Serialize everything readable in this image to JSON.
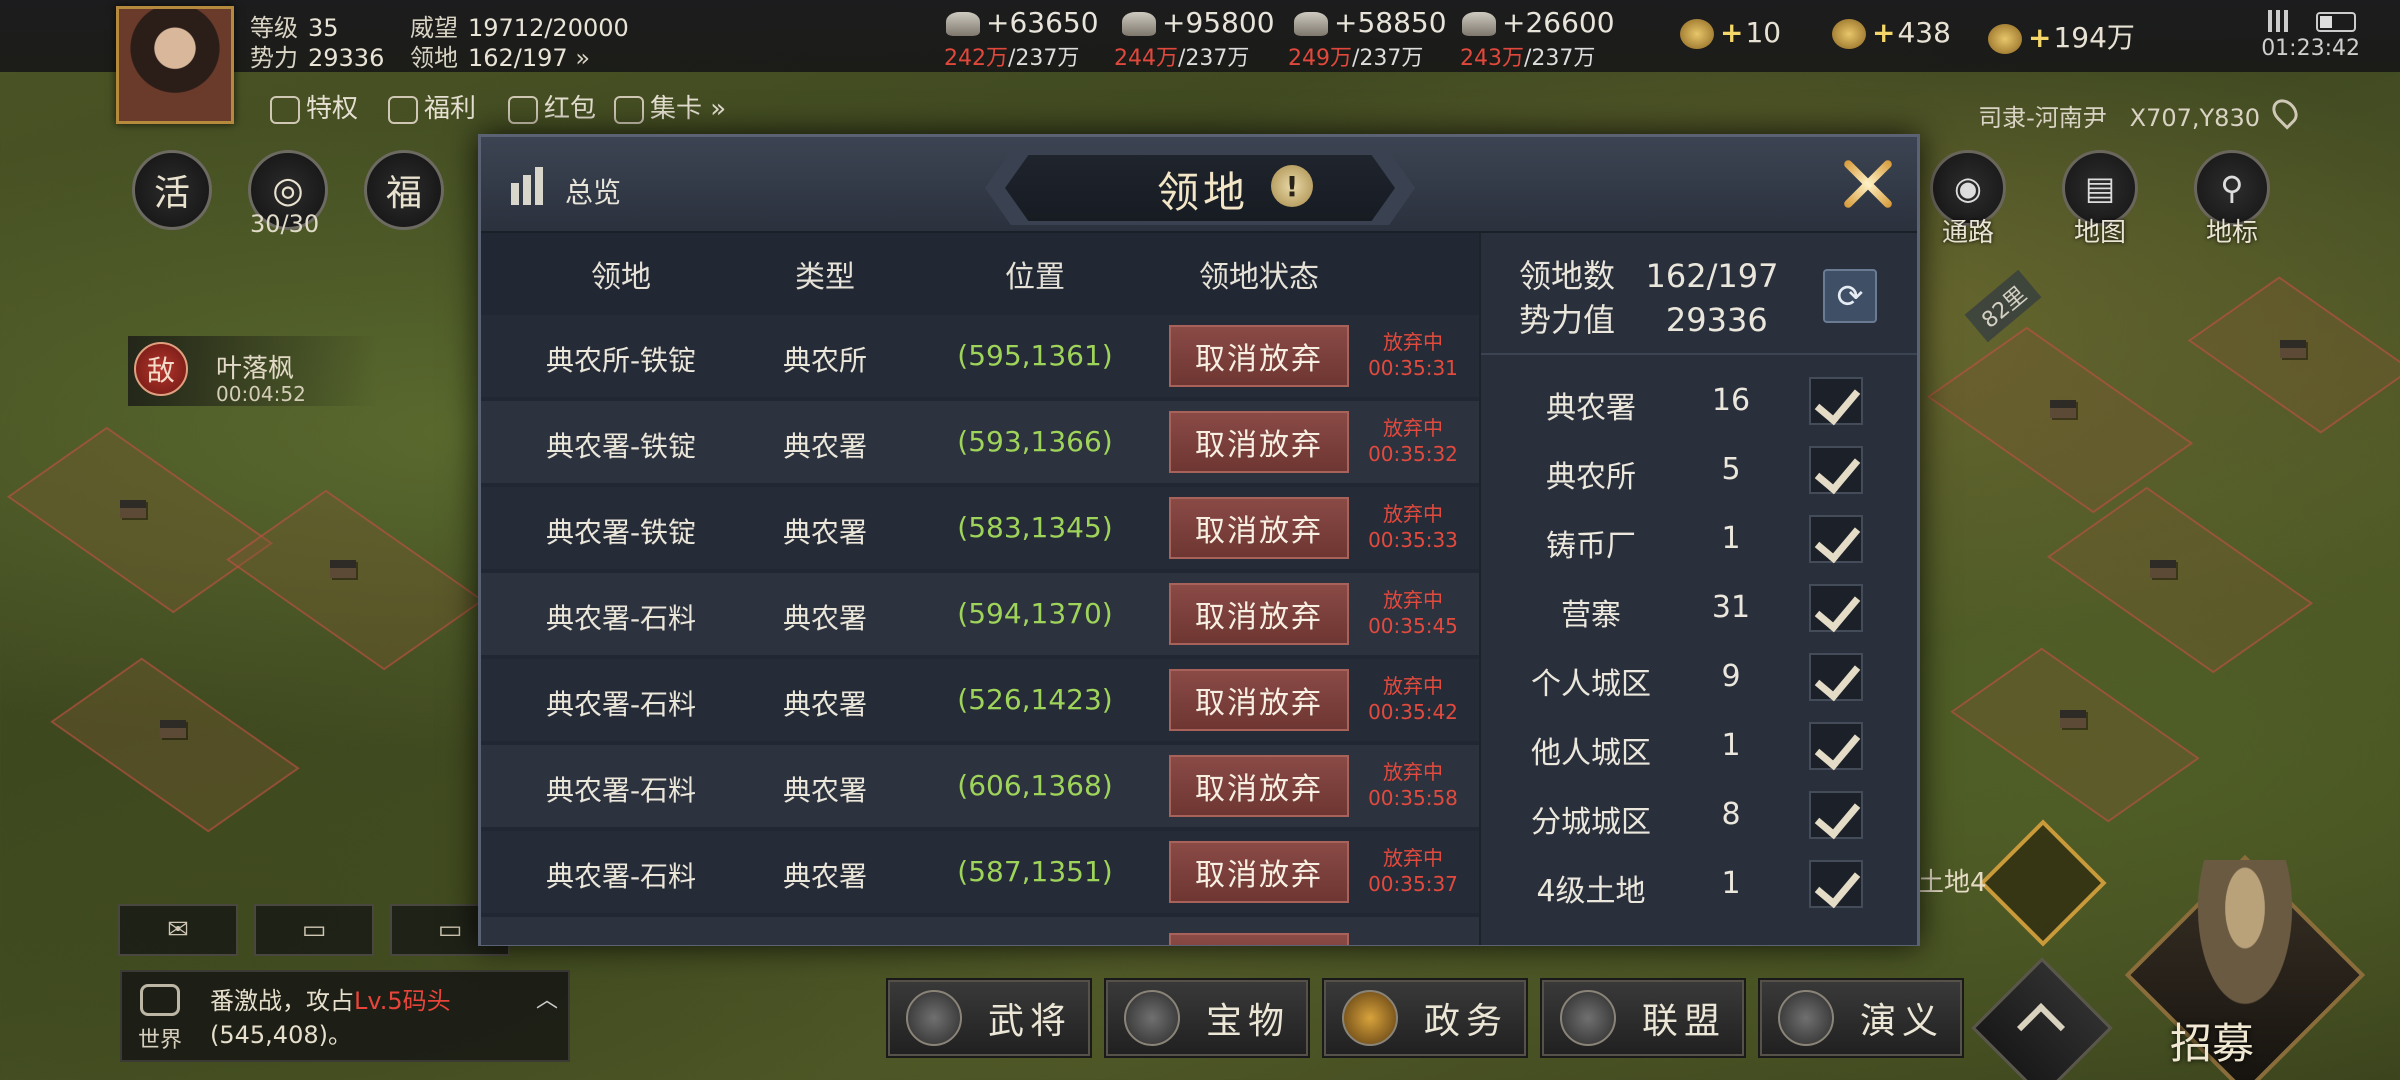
{
  "player": {
    "level_label": "等级",
    "level": "35",
    "power_label": "势力",
    "power": "29336",
    "prestige_label": "威望",
    "prestige": "19712/20000",
    "territory_label": "领地",
    "territory": "162/197"
  },
  "resources": [
    {
      "icon": "wood-icon",
      "gain": "+63650",
      "current": "242万",
      "cap": "/237万"
    },
    {
      "icon": "iron-icon",
      "gain": "+95800",
      "current": "244万",
      "cap": "/237万"
    },
    {
      "icon": "stone-icon",
      "gain": "+58850",
      "current": "249万",
      "cap": "/237万"
    },
    {
      "icon": "grain-icon",
      "gain": "+26600",
      "current": "243万",
      "cap": "/237万"
    }
  ],
  "currencies": [
    {
      "icon": "gold-ingot-icon",
      "value": "10"
    },
    {
      "icon": "gold-coin-icon",
      "value": "438"
    },
    {
      "icon": "copper-coin-icon",
      "value": "194万"
    }
  ],
  "clock": "01:23:42",
  "subbar": [
    "特权",
    "福利",
    "红包",
    "集卡"
  ],
  "left_buttons": [
    {
      "label": "活",
      "caption": ""
    },
    {
      "label": "",
      "caption": "30/30"
    },
    {
      "label": "福",
      "caption": ""
    }
  ],
  "enemy": {
    "badge": "敌",
    "name": "叶落枫",
    "time": "00:04:52"
  },
  "location": {
    "region": "司隶-河南尹",
    "coords": "X707,Y830"
  },
  "right_icons": [
    {
      "icon": "eye-icon",
      "label": "通路"
    },
    {
      "icon": "map-icon",
      "label": "地图"
    },
    {
      "icon": "marker-icon",
      "label": "地标"
    }
  ],
  "map_tags": {
    "distance": "82里",
    "land": "土地4"
  },
  "modal": {
    "overview": "总览",
    "title": "领地",
    "info": "!",
    "columns": [
      "领地",
      "类型",
      "位置",
      "领地状态"
    ],
    "rows": [
      {
        "name": "典农所-铁锭",
        "type": "典农所",
        "pos": "(595,1361)",
        "action": "取消放弃",
        "status": "放弃中",
        "time": "00:35:31"
      },
      {
        "name": "典农署-铁锭",
        "type": "典农署",
        "pos": "(593,1366)",
        "action": "取消放弃",
        "status": "放弃中",
        "time": "00:35:32"
      },
      {
        "name": "典农署-铁锭",
        "type": "典农署",
        "pos": "(583,1345)",
        "action": "取消放弃",
        "status": "放弃中",
        "time": "00:35:33"
      },
      {
        "name": "典农署-石料",
        "type": "典农署",
        "pos": "(594,1370)",
        "action": "取消放弃",
        "status": "放弃中",
        "time": "00:35:45"
      },
      {
        "name": "典农署-石料",
        "type": "典农署",
        "pos": "(526,1423)",
        "action": "取消放弃",
        "status": "放弃中",
        "time": "00:35:42"
      },
      {
        "name": "典农署-石料",
        "type": "典农署",
        "pos": "(606,1368)",
        "action": "取消放弃",
        "status": "放弃中",
        "time": "00:35:58"
      },
      {
        "name": "典农署-石料",
        "type": "典农署",
        "pos": "(587,1351)",
        "action": "取消放弃",
        "status": "放弃中",
        "time": "00:35:37"
      }
    ],
    "summary": {
      "count_label": "领地数",
      "count": "162/197",
      "power_label": "势力值",
      "power": "29336"
    },
    "filters": [
      {
        "name": "典农署",
        "count": "16",
        "checked": true
      },
      {
        "name": "典农所",
        "count": "5",
        "checked": true
      },
      {
        "name": "铸币厂",
        "count": "1",
        "checked": true
      },
      {
        "name": "营寨",
        "count": "31",
        "checked": true
      },
      {
        "name": "个人城区",
        "count": "9",
        "checked": true
      },
      {
        "name": "他人城区",
        "count": "1",
        "checked": true
      },
      {
        "name": "分城城区",
        "count": "8",
        "checked": true
      },
      {
        "name": "4级土地",
        "count": "1",
        "checked": true
      }
    ]
  },
  "chat": {
    "channel": "世界",
    "msg_prefix": "番激战，攻占",
    "msg_highlight": "Lv.5码头",
    "msg_suffix": "(545,408)。"
  },
  "nav": [
    {
      "icon": "general-icon",
      "label": "武将"
    },
    {
      "icon": "treasure-icon",
      "label": "宝物"
    },
    {
      "icon": "politics-icon",
      "label": "政务"
    },
    {
      "icon": "alliance-icon",
      "label": "联盟"
    },
    {
      "icon": "saga-icon",
      "label": "演义"
    }
  ],
  "recruit": "招募"
}
